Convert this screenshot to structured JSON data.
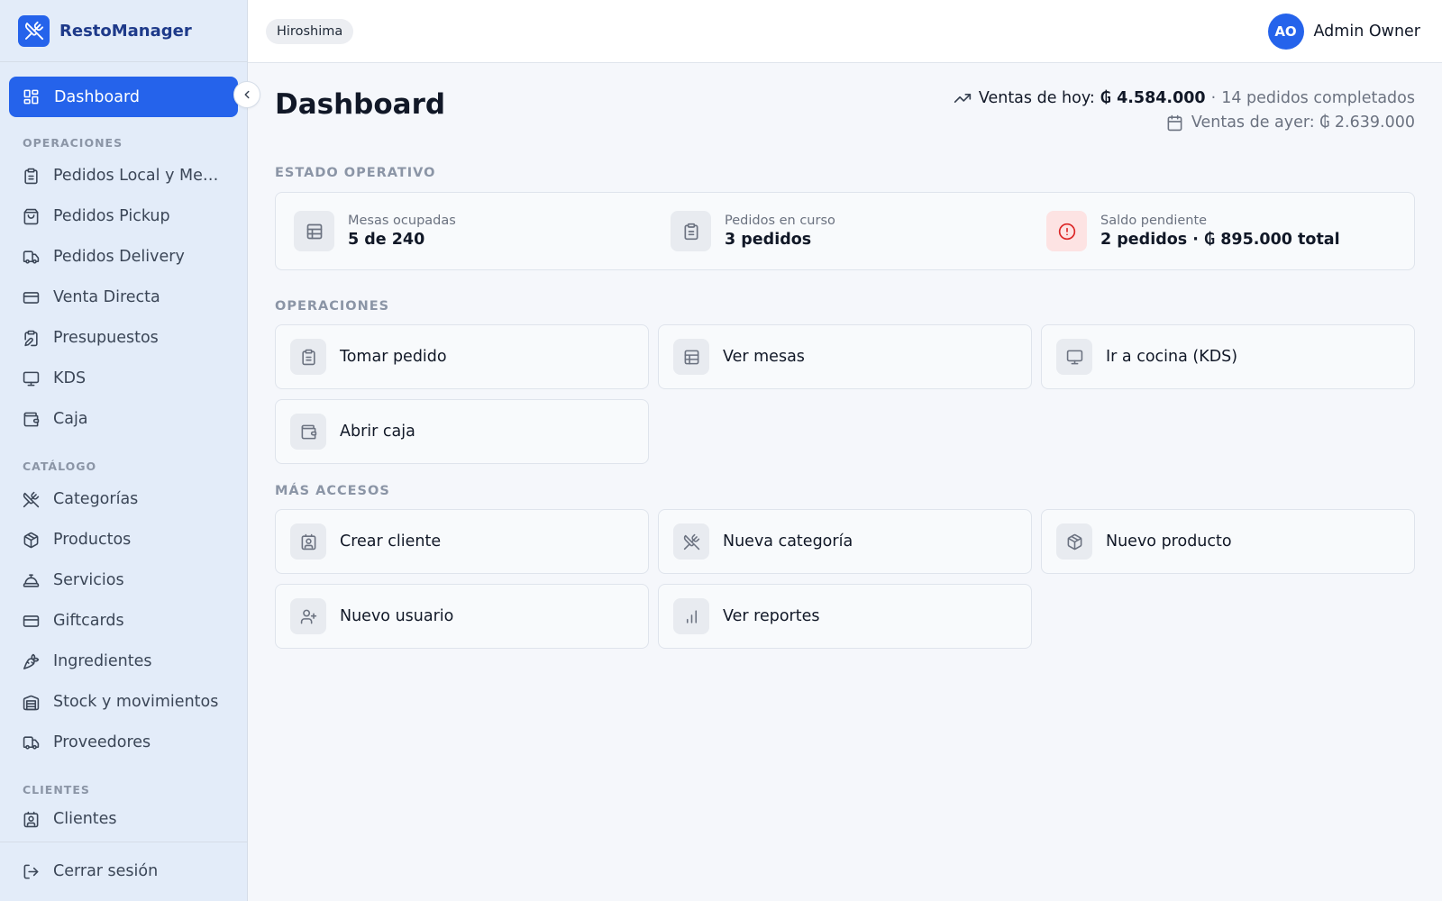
{
  "brand": {
    "name": "RestoManager"
  },
  "topbar": {
    "branch": "Hiroshima",
    "user_initials": "AO",
    "user_name": "Admin Owner"
  },
  "sidebar": {
    "active": {
      "label": "Dashboard",
      "icon": "grid-icon"
    },
    "sections": [
      {
        "title": "OPERACIONES",
        "items": [
          {
            "label": "Pedidos Local y Mesas",
            "icon": "clipboard-icon"
          },
          {
            "label": "Pedidos Pickup",
            "icon": "shopping-bag-icon"
          },
          {
            "label": "Pedidos Delivery",
            "icon": "truck-icon"
          },
          {
            "label": "Venta Directa",
            "icon": "credit-card-icon"
          },
          {
            "label": "Presupuestos",
            "icon": "clipboard-edit-icon"
          },
          {
            "label": "KDS",
            "icon": "monitor-icon"
          },
          {
            "label": "Caja",
            "icon": "wallet-icon"
          }
        ]
      },
      {
        "title": "CATÁLOGO",
        "items": [
          {
            "label": "Categorías",
            "icon": "utensils-crossed-icon"
          },
          {
            "label": "Productos",
            "icon": "package-icon"
          },
          {
            "label": "Servicios",
            "icon": "concierge-bell-icon"
          },
          {
            "label": "Giftcards",
            "icon": "credit-card-icon"
          },
          {
            "label": "Ingredientes",
            "icon": "carrot-icon"
          },
          {
            "label": "Stock y movimientos",
            "icon": "warehouse-icon"
          },
          {
            "label": "Proveedores",
            "icon": "truck-icon"
          }
        ]
      },
      {
        "title": "CLIENTES",
        "items": [
          {
            "label": "Clientes",
            "icon": "contact-icon"
          }
        ]
      }
    ],
    "logout": {
      "label": "Cerrar sesión",
      "icon": "log-out-icon"
    }
  },
  "header": {
    "title": "Dashboard",
    "sales_today_label": "Ventas de hoy:",
    "sales_today_value": "₲ 4.584.000",
    "sales_today_sep": "·",
    "sales_today_orders": "14 pedidos completados",
    "sales_yesterday": "Ventas de ayer: ₲ 2.639.000"
  },
  "status": {
    "title": "ESTADO OPERATIVO",
    "items": [
      {
        "label": "Mesas ocupadas",
        "value": "5 de 240",
        "icon": "table-icon"
      },
      {
        "label": "Pedidos en curso",
        "value": "3 pedidos",
        "icon": "clipboard-icon"
      },
      {
        "label": "Saldo pendiente",
        "value": "2 pedidos · ₲ 895.000 total",
        "icon": "alert-circle-icon"
      }
    ]
  },
  "operations": {
    "title": "OPERACIONES",
    "tiles": [
      {
        "label": "Tomar pedido",
        "icon": "clipboard-icon"
      },
      {
        "label": "Ver mesas",
        "icon": "table-icon"
      },
      {
        "label": "Ir a cocina (KDS)",
        "icon": "monitor-icon"
      },
      {
        "label": "Abrir caja",
        "icon": "wallet-icon"
      }
    ]
  },
  "more": {
    "title": "MÁS ACCESOS",
    "tiles": [
      {
        "label": "Crear cliente",
        "icon": "contact-icon"
      },
      {
        "label": "Nueva categoría",
        "icon": "utensils-crossed-icon"
      },
      {
        "label": "Nuevo producto",
        "icon": "package-icon"
      },
      {
        "label": "Nuevo usuario",
        "icon": "user-plus-icon"
      },
      {
        "label": "Ver reportes",
        "icon": "bar-chart-icon"
      }
    ]
  },
  "colors": {
    "accent": "#2563eb",
    "sidebar_bg": "#e3ecf9",
    "warning": "#dc2626"
  }
}
